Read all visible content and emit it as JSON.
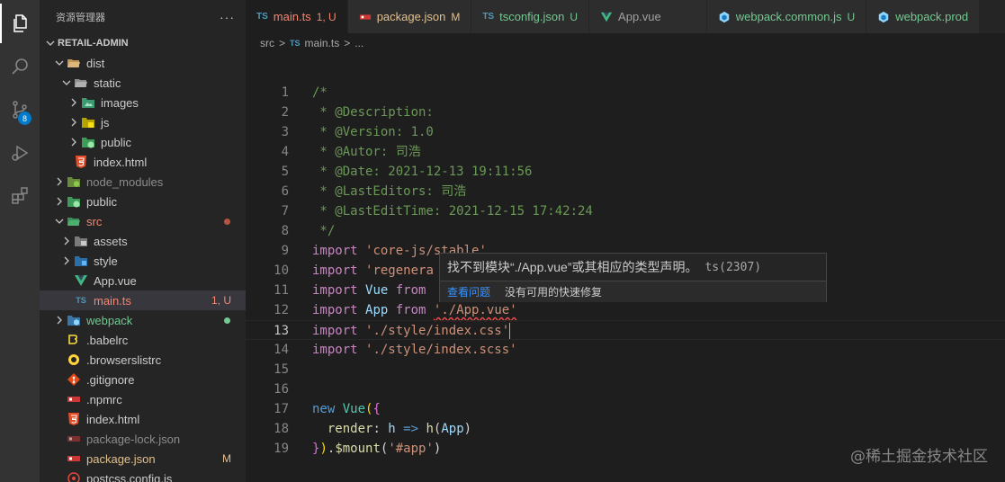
{
  "sidebar": {
    "title": "资源管理器",
    "more": "···",
    "project": "RETAIL-ADMIN",
    "items": [
      {
        "label": "dist",
        "status": ""
      },
      {
        "label": "static",
        "status": ""
      },
      {
        "label": "images",
        "status": ""
      },
      {
        "label": "js",
        "status": ""
      },
      {
        "label": "public",
        "status": ""
      },
      {
        "label": "index.html",
        "status": ""
      },
      {
        "label": "node_modules",
        "status": ""
      },
      {
        "label": "public",
        "status": ""
      },
      {
        "label": "src",
        "status": ""
      },
      {
        "label": "assets",
        "status": ""
      },
      {
        "label": "style",
        "status": ""
      },
      {
        "label": "App.vue",
        "status": ""
      },
      {
        "label": "main.ts",
        "status": "1, U"
      },
      {
        "label": "webpack",
        "status": ""
      },
      {
        "label": ".babelrc",
        "status": ""
      },
      {
        "label": ".browserslistrc",
        "status": ""
      },
      {
        "label": ".gitignore",
        "status": ""
      },
      {
        "label": ".npmrc",
        "status": ""
      },
      {
        "label": "index.html",
        "status": ""
      },
      {
        "label": "package-lock.json",
        "status": ""
      },
      {
        "label": "package.json",
        "status": "M"
      },
      {
        "label": "postcss.config.js",
        "status": ""
      }
    ]
  },
  "activity": {
    "scm_badge": "8"
  },
  "tabs": [
    {
      "icon": "TS",
      "label": "main.ts",
      "status": "1, U"
    },
    {
      "icon": "{}",
      "label": "package.json",
      "status": "M"
    },
    {
      "icon": "TS",
      "label": "tsconfig.json",
      "status": "U"
    },
    {
      "icon": "vue",
      "label": "App.vue",
      "status": ""
    },
    {
      "icon": "webpack",
      "label": "webpack.common.js",
      "status": "U"
    },
    {
      "icon": "webpack",
      "label": "webpack.prod",
      "status": ""
    }
  ],
  "breadcrumb": {
    "folder": "src",
    "sep": ">",
    "file_icon": "TS",
    "file": "main.ts",
    "more": "..."
  },
  "code": {
    "line_numbers": [
      "1",
      "2",
      "3",
      "4",
      "5",
      "6",
      "7",
      "8",
      "9",
      "10",
      "11",
      "12",
      "13",
      "14",
      "15",
      "16",
      "17",
      "18",
      "19"
    ],
    "l1": "/*",
    "l2": " * @Description:",
    "l3": " * @Version: 1.0",
    "l4": " * @Autor: 司浩",
    "l5": " * @Date: 2021-12-13 19:11:56",
    "l6": " * @LastEditors: 司浩",
    "l7": " * @LastEditTime: 2021-12-15 17:42:24",
    "l8": " */",
    "kw_import": "import",
    "kw_from": "from",
    "kw_new": "new",
    "l9_str": "'core-js/stable'",
    "l10_str": "'regenera",
    "l11_id": "Vue",
    "l12_id": "App",
    "l12_str": "'./App.vue'",
    "l13_str": "'./style/index.css'",
    "l14_str": "'./style/index.scss'",
    "l17_cls": "Vue",
    "l18_render": "render",
    "l18_h": "h",
    "l18_arrow": "=>",
    "l18_call": "h",
    "l18_arg": "App",
    "l19_mount": "$mount",
    "l19_str": "'#app'"
  },
  "hover": {
    "message": "找不到模块“./App.vue”或其相应的类型声明。",
    "code": "ts(2307)",
    "view_problem": "查看问题",
    "no_fix": "没有可用的快速修复"
  },
  "watermark": "@稀土掘金技术社区",
  "colors": {
    "accent": "#007acc",
    "modified": "#e2c08d",
    "error": "#f48771",
    "untracked": "#73c991"
  }
}
